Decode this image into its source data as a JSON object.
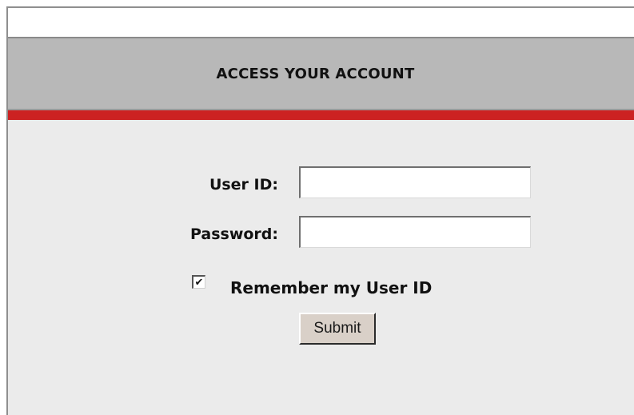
{
  "header": {
    "title": "ACCESS YOUR ACCOUNT"
  },
  "form": {
    "userid_label": "User ID:",
    "userid_value": "",
    "password_label": "Password:",
    "password_value": "",
    "remember_label": "Remember my User ID",
    "remember_checked": true,
    "checkbox_glyph": "✔",
    "submit_label": "Submit"
  },
  "colors": {
    "accent_red": "#cc2222",
    "header_gray": "#b8b8b8",
    "panel_gray": "#ebebeb",
    "button_face": "#d9d0c8"
  }
}
